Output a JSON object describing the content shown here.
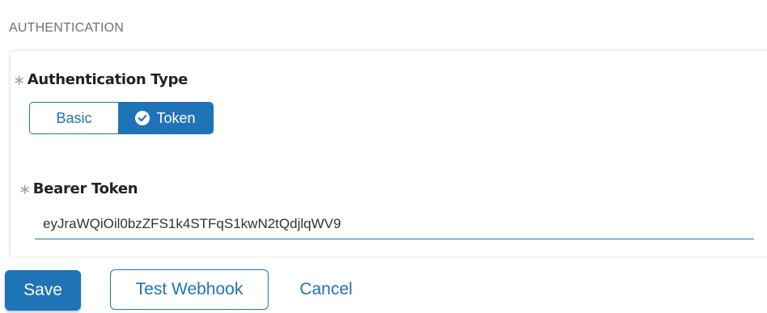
{
  "section": {
    "heading": "AUTHENTICATION"
  },
  "auth_type": {
    "required_marker": "∗",
    "label": "Authentication Type",
    "options": [
      {
        "label": "Basic",
        "selected": false
      },
      {
        "label": "Token",
        "selected": true
      }
    ],
    "selected_icon": "check-circle-icon"
  },
  "bearer_token": {
    "required_marker": "∗",
    "label": "Bearer Token",
    "value": "eyJraWQiOil0bzZFS1k4STFqS1kwN2tQdjlqWV9"
  },
  "actions": {
    "save_label": "Save",
    "test_label": "Test Webhook",
    "cancel_label": "Cancel"
  },
  "colors": {
    "accent": "#1f73b7",
    "heading": "#707070",
    "required": "#a0a0a0"
  }
}
